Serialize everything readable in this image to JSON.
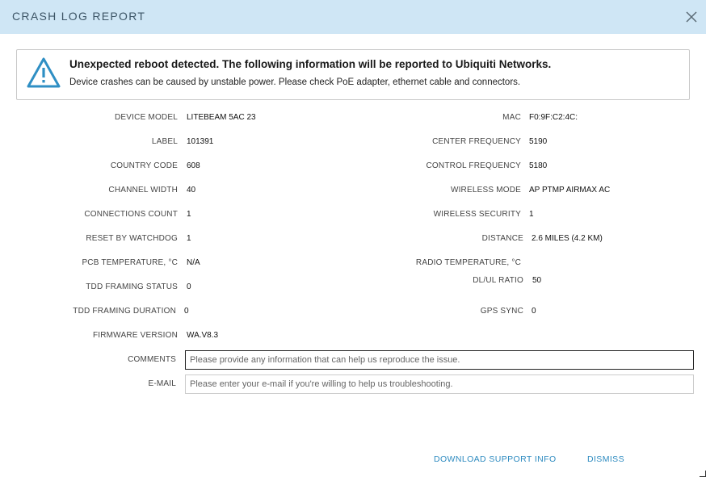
{
  "header": {
    "title": "CRASH LOG REPORT"
  },
  "alert": {
    "headline": "Unexpected reboot detected. The following information will be reported to Ubiquiti Networks.",
    "subline": "Device crashes can be caused by unstable power. Please check PoE adapter, ethernet cable and connectors."
  },
  "left": {
    "device_model": {
      "label": "DEVICE MODEL",
      "value": "LITEBEAM 5AC 23"
    },
    "label": {
      "label": "LABEL",
      "value": "101391"
    },
    "country_code": {
      "label": "COUNTRY CODE",
      "value": "608"
    },
    "channel_width": {
      "label": "CHANNEL WIDTH",
      "value": "40"
    },
    "connections_count": {
      "label": "CONNECTIONS COUNT",
      "value": "1"
    },
    "reset_by_watchdog": {
      "label": "RESET BY WATCHDOG",
      "value": "1"
    },
    "pcb_temperature": {
      "label": "PCB TEMPERATURE, °C",
      "value": "N/A"
    },
    "tdd_framing_status": {
      "label": "TDD FRAMING STATUS",
      "value": "0"
    },
    "tdd_framing_duration": {
      "label": "TDD FRAMING DURATION",
      "value": "0"
    },
    "firmware_version": {
      "label": "FIRMWARE VERSION",
      "value": "WA.V8.3"
    }
  },
  "right": {
    "mac": {
      "label": "MAC",
      "value": "F0:9F:C2:4C:"
    },
    "center_frequency": {
      "label": "CENTER FREQUENCY",
      "value": "5190"
    },
    "control_frequency": {
      "label": "CONTROL FREQUENCY",
      "value": "5180"
    },
    "wireless_mode": {
      "label": "WIRELESS MODE",
      "value": "AP PTMP AIRMAX AC"
    },
    "wireless_security": {
      "label": "WIRELESS SECURITY",
      "value": "1"
    },
    "distance": {
      "label": "DISTANCE",
      "value": "2.6 MILES (4.2 KM)"
    },
    "radio_temperature": {
      "label": "RADIO TEMPERATURE, °C",
      "value": ""
    },
    "dl_ul_ratio": {
      "label": "DL/UL RATIO",
      "value": "50"
    },
    "gps_sync": {
      "label": "GPS SYNC",
      "value": "0"
    }
  },
  "form": {
    "comments_label": "COMMENTS",
    "comments_value": "",
    "comments_placeholder": "Please provide any information that can help us reproduce the issue.",
    "email_label": "E-MAIL",
    "email_value": "",
    "email_placeholder": "Please enter your e-mail if you're willing to help us troubleshooting."
  },
  "actions": {
    "download_label": "DOWNLOAD SUPPORT INFO",
    "dismiss_label": "DISMISS"
  },
  "icons": {
    "warning": "warning-triangle-icon",
    "close": "close-icon"
  },
  "colors": {
    "header_bg": "#cfe6f5",
    "accent": "#2e8bc0",
    "warning_icon": "#2f8fc4"
  }
}
